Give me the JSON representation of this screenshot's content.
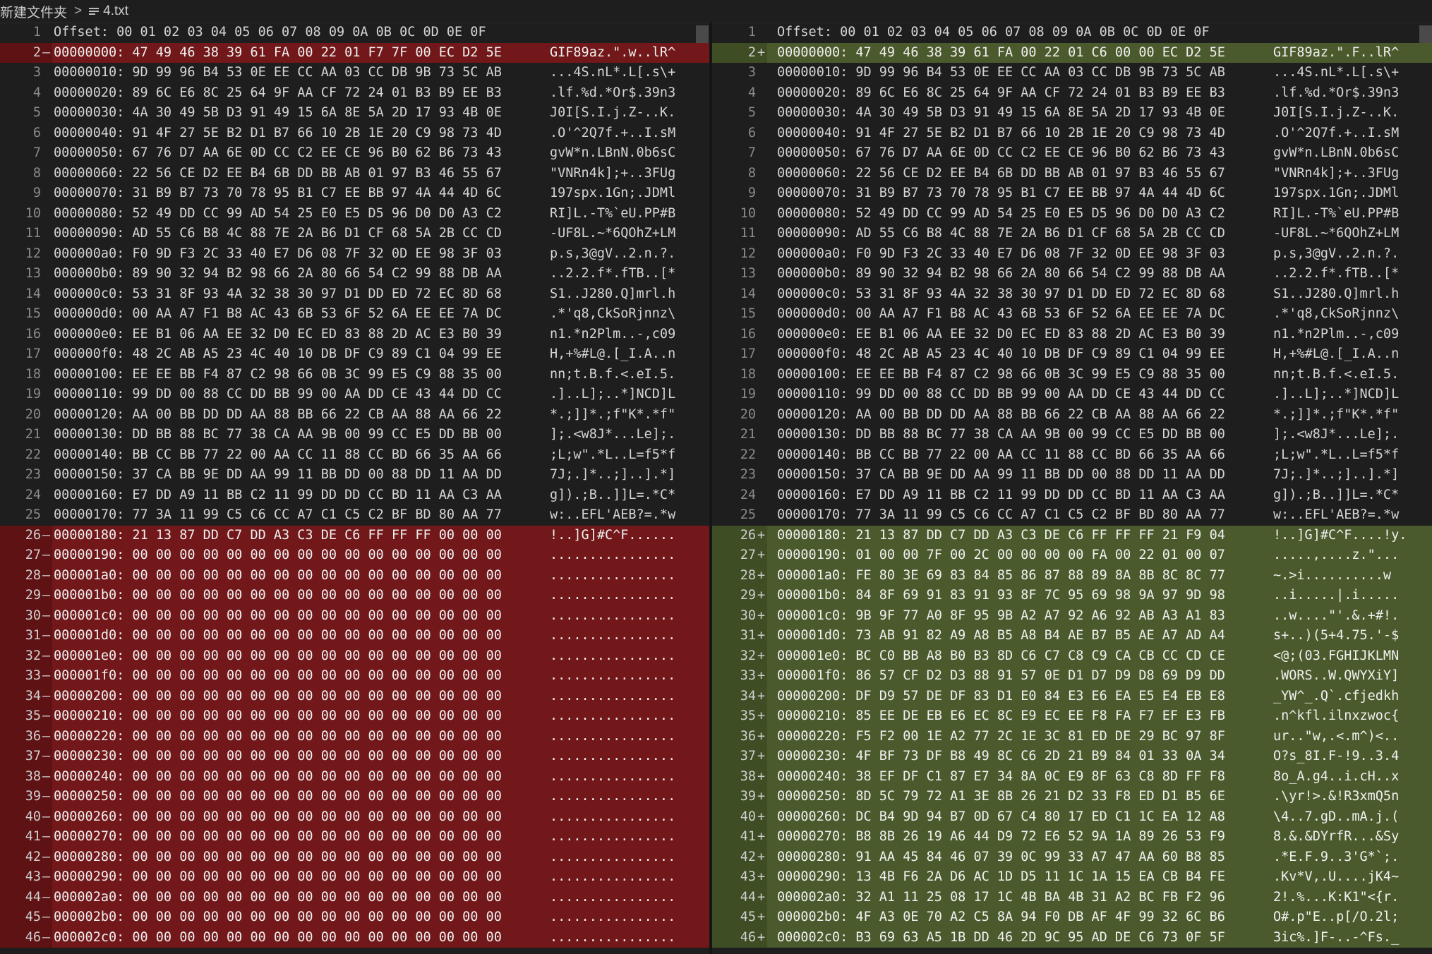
{
  "breadcrumb": {
    "folder": "新建文件夹",
    "separator": ">",
    "file_icon": "file-lines-icon",
    "file": "4.txt"
  },
  "colors": {
    "removed_bg": "#72181a",
    "added_bg": "#4b5a2c",
    "editor_bg": "#1e1e1e"
  },
  "header": {
    "hex": "Offset: 00 01 02 03 04 05 06 07 08 09 0A 0B 0C 0D 0E 0F",
    "ascii": ""
  },
  "left_rows": [
    {
      "n": "2",
      "m": "—",
      "t": "rem",
      "hex": "00000000: 47 49 46 38 39 61 FA 00 22 01 F7 7F 00 EC D2 5E",
      "asc": "GIF89az.\".w..lR^"
    },
    {
      "n": "3",
      "m": "",
      "t": "",
      "hex": "00000010: 9D 99 96 B4 53 0E EE CC AA 03 CC DB 9B 73 5C AB",
      "asc": "...4S.nL*.L[.s\\+"
    },
    {
      "n": "4",
      "m": "",
      "t": "",
      "hex": "00000020: 89 6C E6 8C 25 64 9F AA CF 72 24 01 B3 B9 EE B3",
      "asc": ".lf.%d.*Or$.39n3"
    },
    {
      "n": "5",
      "m": "",
      "t": "",
      "hex": "00000030: 4A 30 49 5B D3 91 49 15 6A 8E 5A 2D 17 93 4B 0E",
      "asc": "J0I[S.I.j.Z-..K."
    },
    {
      "n": "6",
      "m": "",
      "t": "",
      "hex": "00000040: 91 4F 27 5E B2 D1 B7 66 10 2B 1E 20 C9 98 73 4D",
      "asc": ".O'^2Q7f.+..I.sM"
    },
    {
      "n": "7",
      "m": "",
      "t": "",
      "hex": "00000050: 67 76 D7 AA 6E 0D CC C2 EE CE 96 B0 62 B6 73 43",
      "asc": "gvW*n.LBnN.0b6sC"
    },
    {
      "n": "8",
      "m": "",
      "t": "",
      "hex": "00000060: 22 56 CE D2 EE B4 6B DD BB AB 01 97 B3 46 55 67",
      "asc": "\"VNRn4k];+..3FUg"
    },
    {
      "n": "9",
      "m": "",
      "t": "",
      "hex": "00000070: 31 B9 B7 73 70 78 95 B1 C7 EE BB 97 4A 44 4D 6C",
      "asc": "197spx.1Gn;.JDMl"
    },
    {
      "n": "10",
      "m": "",
      "t": "",
      "hex": "00000080: 52 49 DD CC 99 AD 54 25 E0 E5 D5 96 D0 D0 A3 C2",
      "asc": "RI]L.-T%`eU.PP#B"
    },
    {
      "n": "11",
      "m": "",
      "t": "",
      "hex": "00000090: AD 55 C6 B8 4C 88 7E 2A B6 D1 CF 68 5A 2B CC CD",
      "asc": "-UF8L.~*6QOhZ+LM"
    },
    {
      "n": "12",
      "m": "",
      "t": "",
      "hex": "000000a0: F0 9D F3 2C 33 40 E7 D6 08 7F 32 0D EE 98 3F 03",
      "asc": "p.s,3@gV..2.n.?."
    },
    {
      "n": "13",
      "m": "",
      "t": "",
      "hex": "000000b0: 89 90 32 94 B2 98 66 2A 80 66 54 C2 99 88 DB AA",
      "asc": "..2.2.f*.fTB..[*"
    },
    {
      "n": "14",
      "m": "",
      "t": "",
      "hex": "000000c0: 53 31 8F 93 4A 32 38 30 97 D1 DD ED 72 EC 8D 68",
      "asc": "S1..J280.Q]mrl.h"
    },
    {
      "n": "15",
      "m": "",
      "t": "",
      "hex": "000000d0: 00 AA A7 F1 B8 AC 43 6B 53 6F 52 6A EE EE 7A DC",
      "asc": ".*'q8,CkSoRjnnz\\"
    },
    {
      "n": "16",
      "m": "",
      "t": "",
      "hex": "000000e0: EE B1 06 AA EE 32 D0 EC ED 83 88 2D AC E3 B0 39",
      "asc": "n1.*n2Plm..-,c09"
    },
    {
      "n": "17",
      "m": "",
      "t": "",
      "hex": "000000f0: 48 2C AB A5 23 4C 40 10 DB DF C9 89 C1 04 99 EE",
      "asc": "H,+%#L@.[_I.A..n"
    },
    {
      "n": "18",
      "m": "",
      "t": "",
      "hex": "00000100: EE EE BB F4 87 C2 98 66 0B 3C 99 E5 C9 88 35 00",
      "asc": "nn;t.B.f.<.eI.5."
    },
    {
      "n": "19",
      "m": "",
      "t": "",
      "hex": "00000110: 99 DD 00 88 CC DD BB 99 00 AA DD CE 43 44 DD CC",
      "asc": ".]..L];..*]NCD]L"
    },
    {
      "n": "20",
      "m": "",
      "t": "",
      "hex": "00000120: AA 00 BB DD DD AA 88 BB 66 22 CB AA 88 AA 66 22",
      "asc": "*.;]]*.;f\"K*.*f\""
    },
    {
      "n": "21",
      "m": "",
      "t": "",
      "hex": "00000130: DD BB 88 BC 77 38 CA AA 9B 00 99 CC E5 DD BB 00",
      "asc": "];.<w8J*...Le];."
    },
    {
      "n": "22",
      "m": "",
      "t": "",
      "hex": "00000140: BB CC BB 77 22 00 AA CC 11 88 CC BD 66 35 AA 66",
      "asc": ";L;w\".*L..L=f5*f"
    },
    {
      "n": "23",
      "m": "",
      "t": "",
      "hex": "00000150: 37 CA BB 9E DD AA 99 11 BB DD 00 88 DD 11 AA DD",
      "asc": "7J;.]*..;]..].*]"
    },
    {
      "n": "24",
      "m": "",
      "t": "",
      "hex": "00000160: E7 DD A9 11 BB C2 11 99 DD DD CC BD 11 AA C3 AA",
      "asc": "g]).;B..]]L=.*C*"
    },
    {
      "n": "25",
      "m": "",
      "t": "",
      "hex": "00000170: 77 3A 11 99 C5 C6 CC A7 C1 C5 C2 BF BD 80 AA 77",
      "asc": "w:..EFL'AEB?=.*w"
    },
    {
      "n": "26",
      "m": "—",
      "t": "rem",
      "hex": "00000180: 21 13 87 DD C7 DD A3 C3 DE C6 FF FF FF 00 00 00",
      "asc": "!..]G]#C^F......"
    },
    {
      "n": "27",
      "m": "—",
      "t": "rem",
      "hex": "00000190: 00 00 00 00 00 00 00 00 00 00 00 00 00 00 00 00",
      "asc": "................"
    },
    {
      "n": "28",
      "m": "—",
      "t": "rem",
      "hex": "000001a0: 00 00 00 00 00 00 00 00 00 00 00 00 00 00 00 00",
      "asc": "................"
    },
    {
      "n": "29",
      "m": "—",
      "t": "rem",
      "hex": "000001b0: 00 00 00 00 00 00 00 00 00 00 00 00 00 00 00 00",
      "asc": "................"
    },
    {
      "n": "30",
      "m": "—",
      "t": "rem",
      "hex": "000001c0: 00 00 00 00 00 00 00 00 00 00 00 00 00 00 00 00",
      "asc": "................"
    },
    {
      "n": "31",
      "m": "—",
      "t": "rem",
      "hex": "000001d0: 00 00 00 00 00 00 00 00 00 00 00 00 00 00 00 00",
      "asc": "................"
    },
    {
      "n": "32",
      "m": "—",
      "t": "rem",
      "hex": "000001e0: 00 00 00 00 00 00 00 00 00 00 00 00 00 00 00 00",
      "asc": "................"
    },
    {
      "n": "33",
      "m": "—",
      "t": "rem",
      "hex": "000001f0: 00 00 00 00 00 00 00 00 00 00 00 00 00 00 00 00",
      "asc": "................"
    },
    {
      "n": "34",
      "m": "—",
      "t": "rem",
      "hex": "00000200: 00 00 00 00 00 00 00 00 00 00 00 00 00 00 00 00",
      "asc": "................"
    },
    {
      "n": "35",
      "m": "—",
      "t": "rem",
      "hex": "00000210: 00 00 00 00 00 00 00 00 00 00 00 00 00 00 00 00",
      "asc": "................"
    },
    {
      "n": "36",
      "m": "—",
      "t": "rem",
      "hex": "00000220: 00 00 00 00 00 00 00 00 00 00 00 00 00 00 00 00",
      "asc": "................"
    },
    {
      "n": "37",
      "m": "—",
      "t": "rem",
      "hex": "00000230: 00 00 00 00 00 00 00 00 00 00 00 00 00 00 00 00",
      "asc": "................"
    },
    {
      "n": "38",
      "m": "—",
      "t": "rem",
      "hex": "00000240: 00 00 00 00 00 00 00 00 00 00 00 00 00 00 00 00",
      "asc": "................"
    },
    {
      "n": "39",
      "m": "—",
      "t": "rem",
      "hex": "00000250: 00 00 00 00 00 00 00 00 00 00 00 00 00 00 00 00",
      "asc": "................"
    },
    {
      "n": "40",
      "m": "—",
      "t": "rem",
      "hex": "00000260: 00 00 00 00 00 00 00 00 00 00 00 00 00 00 00 00",
      "asc": "................"
    },
    {
      "n": "41",
      "m": "—",
      "t": "rem",
      "hex": "00000270: 00 00 00 00 00 00 00 00 00 00 00 00 00 00 00 00",
      "asc": "................"
    },
    {
      "n": "42",
      "m": "—",
      "t": "rem",
      "hex": "00000280: 00 00 00 00 00 00 00 00 00 00 00 00 00 00 00 00",
      "asc": "................"
    },
    {
      "n": "43",
      "m": "—",
      "t": "rem",
      "hex": "00000290: 00 00 00 00 00 00 00 00 00 00 00 00 00 00 00 00",
      "asc": "................"
    },
    {
      "n": "44",
      "m": "—",
      "t": "rem",
      "hex": "000002a0: 00 00 00 00 00 00 00 00 00 00 00 00 00 00 00 00",
      "asc": "................"
    },
    {
      "n": "45",
      "m": "—",
      "t": "rem",
      "hex": "000002b0: 00 00 00 00 00 00 00 00 00 00 00 00 00 00 00 00",
      "asc": "................"
    },
    {
      "n": "46",
      "m": "—",
      "t": "rem",
      "hex": "000002c0: 00 00 00 00 00 00 00 00 00 00 00 00 00 00 00 00",
      "asc": "................"
    }
  ],
  "right_rows": [
    {
      "n": "2",
      "m": "+",
      "t": "add",
      "hex": "00000000: 47 49 46 38 39 61 FA 00 22 01 C6 00 00 EC D2 5E",
      "asc": "GIF89az.\".F..lR^"
    },
    {
      "n": "3",
      "m": "",
      "t": "",
      "hex": "00000010: 9D 99 96 B4 53 0E EE CC AA 03 CC DB 9B 73 5C AB",
      "asc": "...4S.nL*.L[.s\\+"
    },
    {
      "n": "4",
      "m": "",
      "t": "",
      "hex": "00000020: 89 6C E6 8C 25 64 9F AA CF 72 24 01 B3 B9 EE B3",
      "asc": ".lf.%d.*Or$.39n3"
    },
    {
      "n": "5",
      "m": "",
      "t": "",
      "hex": "00000030: 4A 30 49 5B D3 91 49 15 6A 8E 5A 2D 17 93 4B 0E",
      "asc": "J0I[S.I.j.Z-..K."
    },
    {
      "n": "6",
      "m": "",
      "t": "",
      "hex": "00000040: 91 4F 27 5E B2 D1 B7 66 10 2B 1E 20 C9 98 73 4D",
      "asc": ".O'^2Q7f.+..I.sM"
    },
    {
      "n": "7",
      "m": "",
      "t": "",
      "hex": "00000050: 67 76 D7 AA 6E 0D CC C2 EE CE 96 B0 62 B6 73 43",
      "asc": "gvW*n.LBnN.0b6sC"
    },
    {
      "n": "8",
      "m": "",
      "t": "",
      "hex": "00000060: 22 56 CE D2 EE B4 6B DD BB AB 01 97 B3 46 55 67",
      "asc": "\"VNRn4k];+..3FUg"
    },
    {
      "n": "9",
      "m": "",
      "t": "",
      "hex": "00000070: 31 B9 B7 73 70 78 95 B1 C7 EE BB 97 4A 44 4D 6C",
      "asc": "197spx.1Gn;.JDMl"
    },
    {
      "n": "10",
      "m": "",
      "t": "",
      "hex": "00000080: 52 49 DD CC 99 AD 54 25 E0 E5 D5 96 D0 D0 A3 C2",
      "asc": "RI]L.-T%`eU.PP#B"
    },
    {
      "n": "11",
      "m": "",
      "t": "",
      "hex": "00000090: AD 55 C6 B8 4C 88 7E 2A B6 D1 CF 68 5A 2B CC CD",
      "asc": "-UF8L.~*6QOhZ+LM"
    },
    {
      "n": "12",
      "m": "",
      "t": "",
      "hex": "000000a0: F0 9D F3 2C 33 40 E7 D6 08 7F 32 0D EE 98 3F 03",
      "asc": "p.s,3@gV..2.n.?."
    },
    {
      "n": "13",
      "m": "",
      "t": "",
      "hex": "000000b0: 89 90 32 94 B2 98 66 2A 80 66 54 C2 99 88 DB AA",
      "asc": "..2.2.f*.fTB..[*"
    },
    {
      "n": "14",
      "m": "",
      "t": "",
      "hex": "000000c0: 53 31 8F 93 4A 32 38 30 97 D1 DD ED 72 EC 8D 68",
      "asc": "S1..J280.Q]mrl.h"
    },
    {
      "n": "15",
      "m": "",
      "t": "",
      "hex": "000000d0: 00 AA A7 F1 B8 AC 43 6B 53 6F 52 6A EE EE 7A DC",
      "asc": ".*'q8,CkSoRjnnz\\"
    },
    {
      "n": "16",
      "m": "",
      "t": "",
      "hex": "000000e0: EE B1 06 AA EE 32 D0 EC ED 83 88 2D AC E3 B0 39",
      "asc": "n1.*n2Plm..-,c09"
    },
    {
      "n": "17",
      "m": "",
      "t": "",
      "hex": "000000f0: 48 2C AB A5 23 4C 40 10 DB DF C9 89 C1 04 99 EE",
      "asc": "H,+%#L@.[_I.A..n"
    },
    {
      "n": "18",
      "m": "",
      "t": "",
      "hex": "00000100: EE EE BB F4 87 C2 98 66 0B 3C 99 E5 C9 88 35 00",
      "asc": "nn;t.B.f.<.eI.5."
    },
    {
      "n": "19",
      "m": "",
      "t": "",
      "hex": "00000110: 99 DD 00 88 CC DD BB 99 00 AA DD CE 43 44 DD CC",
      "asc": ".]..L];..*]NCD]L"
    },
    {
      "n": "20",
      "m": "",
      "t": "",
      "hex": "00000120: AA 00 BB DD DD AA 88 BB 66 22 CB AA 88 AA 66 22",
      "asc": "*.;]]*.;f\"K*.*f\""
    },
    {
      "n": "21",
      "m": "",
      "t": "",
      "hex": "00000130: DD BB 88 BC 77 38 CA AA 9B 00 99 CC E5 DD BB 00",
      "asc": "];.<w8J*...Le];."
    },
    {
      "n": "22",
      "m": "",
      "t": "",
      "hex": "00000140: BB CC BB 77 22 00 AA CC 11 88 CC BD 66 35 AA 66",
      "asc": ";L;w\".*L..L=f5*f"
    },
    {
      "n": "23",
      "m": "",
      "t": "",
      "hex": "00000150: 37 CA BB 9E DD AA 99 11 BB DD 00 88 DD 11 AA DD",
      "asc": "7J;.]*..;]..].*]"
    },
    {
      "n": "24",
      "m": "",
      "t": "",
      "hex": "00000160: E7 DD A9 11 BB C2 11 99 DD DD CC BD 11 AA C3 AA",
      "asc": "g]).;B..]]L=.*C*"
    },
    {
      "n": "25",
      "m": "",
      "t": "",
      "hex": "00000170: 77 3A 11 99 C5 C6 CC A7 C1 C5 C2 BF BD 80 AA 77",
      "asc": "w:..EFL'AEB?=.*w"
    },
    {
      "n": "26",
      "m": "+",
      "t": "add",
      "hex": "00000180: 21 13 87 DD C7 DD A3 C3 DE C6 FF FF FF 21 F9 04",
      "asc": "!..]G]#C^F....!y."
    },
    {
      "n": "27",
      "m": "+",
      "t": "add",
      "hex": "00000190: 01 00 00 7F 00 2C 00 00 00 00 FA 00 22 01 00 07",
      "asc": ".....,....z.\"..."
    },
    {
      "n": "28",
      "m": "+",
      "t": "add",
      "hex": "000001a0: FE 80 3E 69 83 84 85 86 87 88 89 8A 8B 8C 8C 77",
      "asc": "~.>i..........w"
    },
    {
      "n": "29",
      "m": "+",
      "t": "add",
      "hex": "000001b0: 84 8F 69 91 83 91 93 8F 7C 95 69 98 9A 97 9D 98",
      "asc": "..i.....|.i....."
    },
    {
      "n": "30",
      "m": "+",
      "t": "add",
      "hex": "000001c0: 9B 9F 77 A0 8F 95 9B A2 A7 92 A6 92 AB A3 A1 83",
      "asc": "..w....\"'.&.+#!."
    },
    {
      "n": "31",
      "m": "+",
      "t": "add",
      "hex": "000001d0: 73 AB 91 82 A9 A8 B5 A8 B4 AE B7 B5 AE A7 AD A4",
      "asc": "s+..)(5+4.75.'-$"
    },
    {
      "n": "32",
      "m": "+",
      "t": "add",
      "hex": "000001e0: BC C0 BB A8 B0 B3 8D C6 C7 C8 C9 CA CB CC CD CE",
      "asc": "<@;(03.FGHIJKLMN"
    },
    {
      "n": "33",
      "m": "+",
      "t": "add",
      "hex": "000001f0: 86 57 CF D2 D3 88 91 57 0E D1 D7 D9 D8 69 D9 DD",
      "asc": ".WORS..W.QWYXiY]"
    },
    {
      "n": "34",
      "m": "+",
      "t": "add",
      "hex": "00000200: DF D9 57 DE DF 83 D1 E0 84 E3 E6 EA E5 E4 EB E8",
      "asc": "_YW^_.Q`.cfjedkh"
    },
    {
      "n": "35",
      "m": "+",
      "t": "add",
      "hex": "00000210: 85 EE DE EB E6 EC 8C E9 EC EE F8 FA F7 EF E3 FB",
      "asc": ".n^kfl.ilnxzwoc{"
    },
    {
      "n": "36",
      "m": "+",
      "t": "add",
      "hex": "00000220: F5 F2 00 1E A2 77 2C 1E 3C 81 ED DE 29 BC 97 8F",
      "asc": "ur..\"w,.<.m^)<.."
    },
    {
      "n": "37",
      "m": "+",
      "t": "add",
      "hex": "00000230: 4F BF 73 DF B8 49 8C C6 2D 21 B9 84 01 33 0A 34",
      "asc": "O?s_8I.F-!9..3.4"
    },
    {
      "n": "38",
      "m": "+",
      "t": "add",
      "hex": "00000240: 38 EF DF C1 87 E7 34 8A 0C E9 8F 63 C8 8D FF F8",
      "asc": "8o_A.g4..i.cH..x"
    },
    {
      "n": "39",
      "m": "+",
      "t": "add",
      "hex": "00000250: 8D 5C 79 72 A1 3E 8B 26 21 D2 33 F8 ED D1 B5 6E",
      "asc": ".\\yr!>.&!R3xmQ5n"
    },
    {
      "n": "40",
      "m": "+",
      "t": "add",
      "hex": "00000260: DC B4 9D 94 B7 0D 67 C4 80 17 ED C1 1C EA 12 A8",
      "asc": "\\4..7.gD..mA.j.("
    },
    {
      "n": "41",
      "m": "+",
      "t": "add",
      "hex": "00000270: B8 8B 26 19 A6 44 D9 72 E6 52 9A 1A 89 26 53 F9",
      "asc": "8.&.&DYrfR...&Sy"
    },
    {
      "n": "42",
      "m": "+",
      "t": "add",
      "hex": "00000280: 91 AA 45 84 46 07 39 0C 99 33 A7 47 AA 60 B8 85",
      "asc": ".*E.F.9..3'G*`;."
    },
    {
      "n": "43",
      "m": "+",
      "t": "add",
      "hex": "00000290: 13 4B F6 2A D6 AC 1D D5 11 1C 1A 15 EA CB B4 FE",
      "asc": ".Kv*V,.U....jK4~"
    },
    {
      "n": "44",
      "m": "+",
      "t": "add",
      "hex": "000002a0: 32 A1 11 25 08 17 1C 4B BA 4B 31 A2 BC FB F2 96",
      "asc": "2!.%...K:K1\"<{r."
    },
    {
      "n": "45",
      "m": "+",
      "t": "add",
      "hex": "000002b0: 4F A3 0E 70 A2 C5 8A 94 F0 DB AF 4F 99 32 6C B6",
      "asc": "O#.p\"E..p[/O.2l;"
    },
    {
      "n": "46",
      "m": "+",
      "t": "add",
      "hex": "000002c0: B3 69 63 A5 1B DD 46 2D 9C 95 AD DE C6 73 0F 5F",
      "asc": "3ic%.]F-..-^Fs._"
    }
  ]
}
